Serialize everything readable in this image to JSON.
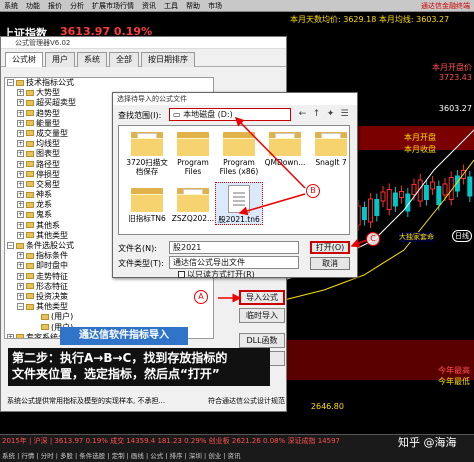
{
  "menubar": {
    "items": [
      "系统",
      "功能",
      "报价",
      "分析",
      "扩展市场行情",
      "资讯",
      "工具",
      "帮助",
      "市场"
    ],
    "right_label": "通达信金融终端"
  },
  "index_bar": {
    "name": "上证指数",
    "value": "3613.97 0.19%",
    "info_line1": "本月天数均价: 3629.18 本月均线: 3603.27",
    "info_line2": "本月均线: 3603.27"
  },
  "chart": {
    "price_labels": [
      "本月开盘价",
      "3723.43",
      "本月均线",
      "3603.27",
      "3648.7",
      "3613.97",
      "3628.8",
      "2646.80",
      "今年最高",
      "今年最低"
    ],
    "labels": [
      "本月开盘",
      "本月收盘",
      "大独家套命",
      "日线"
    ]
  },
  "formula_manager": {
    "title": "公式管理器V6.02",
    "tabs": [
      "公式树",
      "用户",
      "系统",
      "全部",
      "按日期排序"
    ],
    "tree": [
      {
        "label": "技术指标公式",
        "level": 0,
        "exp": "−"
      },
      {
        "label": "大势型",
        "level": 1,
        "exp": "+"
      },
      {
        "label": "超买超卖型",
        "level": 1,
        "exp": "+"
      },
      {
        "label": "趋势型",
        "level": 1,
        "exp": "+"
      },
      {
        "label": "能量型",
        "level": 1,
        "exp": "+"
      },
      {
        "label": "成交量型",
        "level": 1,
        "exp": "+"
      },
      {
        "label": "均线型",
        "level": 1,
        "exp": "+"
      },
      {
        "label": "图表型",
        "level": 1,
        "exp": "+"
      },
      {
        "label": "路径型",
        "level": 1,
        "exp": "+"
      },
      {
        "label": "停损型",
        "level": 1,
        "exp": "+"
      },
      {
        "label": "交易型",
        "level": 1,
        "exp": "+"
      },
      {
        "label": "神系",
        "level": 1,
        "exp": "+"
      },
      {
        "label": "龙系",
        "level": 1,
        "exp": "+"
      },
      {
        "label": "鬼系",
        "level": 1,
        "exp": "+"
      },
      {
        "label": "其他系",
        "level": 1,
        "exp": "+"
      },
      {
        "label": "其他类型",
        "level": 1,
        "exp": "+"
      },
      {
        "label": "条件选股公式",
        "level": 0,
        "exp": "−"
      },
      {
        "label": "指标条件",
        "level": 1,
        "exp": "+"
      },
      {
        "label": "即时盘中",
        "level": 1,
        "exp": "+"
      },
      {
        "label": "走势特征",
        "level": 1,
        "exp": "+"
      },
      {
        "label": "形态特征",
        "level": 1,
        "exp": "+"
      },
      {
        "label": "投资决策",
        "level": 1,
        "exp": "+"
      },
      {
        "label": "其他类型",
        "level": 1,
        "exp": "−"
      },
      {
        "label": "(用户)",
        "level": 2,
        "exp": ""
      },
      {
        "label": "(用户)",
        "level": 2,
        "exp": ""
      },
      {
        "label": "专家系统公式",
        "level": 0,
        "exp": "+"
      },
      {
        "label": "五彩K线公式",
        "level": 0,
        "exp": "+"
      }
    ],
    "buttons": {
      "import": "导入公式",
      "temp_import": "临时导入",
      "dll": "DLL函数",
      "close": "关闭"
    },
    "description_left": "系统公式提供常用指标及模型的实现样本, 不承担...",
    "description_right": "符合通达信公式设计规范"
  },
  "import_dialog": {
    "title": "选择待导入的公式文件",
    "look_in_label": "查找范围(I):",
    "look_in_value": "本地磁盘 (D:)",
    "files": [
      {
        "name": "3720扫描文档保存",
        "type": "folder"
      },
      {
        "name": "Program Files",
        "type": "folder"
      },
      {
        "name": "Program Files (x86)",
        "type": "folder"
      },
      {
        "name": "QMDown...",
        "type": "folder"
      },
      {
        "name": "SnagIt 7",
        "type": "folder"
      },
      {
        "name": "旧指标TN6",
        "type": "folder"
      },
      {
        "name": "ZSZQ202...",
        "type": "folder"
      },
      {
        "name": "股2021.tn6",
        "type": "tn6"
      }
    ],
    "filename_label": "文件名(N):",
    "filename_value": "股2021",
    "filetype_label": "文件类型(T):",
    "filetype_value": "通达信公式导出文件",
    "open_button": "打开(O)",
    "cancel_button": "取消",
    "readonly_label": "以只读方式打开(R)"
  },
  "annotations": {
    "a": "A",
    "b": "B",
    "c": "C",
    "banner": "通达信软件指标导入",
    "step_line1": "第二步：执行A→B→C，找到存放指标的",
    "step_line2": "文件夹位置，选定指标，然后点“打开”"
  },
  "bottom": {
    "line1": "2015年 | 沪深  |  3613.97  0.19%  成交 14359.4 181.23 0.29%  创业板 2621.26 0.08%  深证成指 14597",
    "line2": "系统 | 行情 | 分时 | 多股 | 条件选股 | 定制 | 画线 | 公式 | 排序 | 深圳 | 创业 | 资讯",
    "watermark": "知乎 @海海"
  },
  "colors": {
    "annotation": "#e00000",
    "banner": "#2f74c8",
    "up": "#ff3030",
    "down": "#00c8c8"
  }
}
